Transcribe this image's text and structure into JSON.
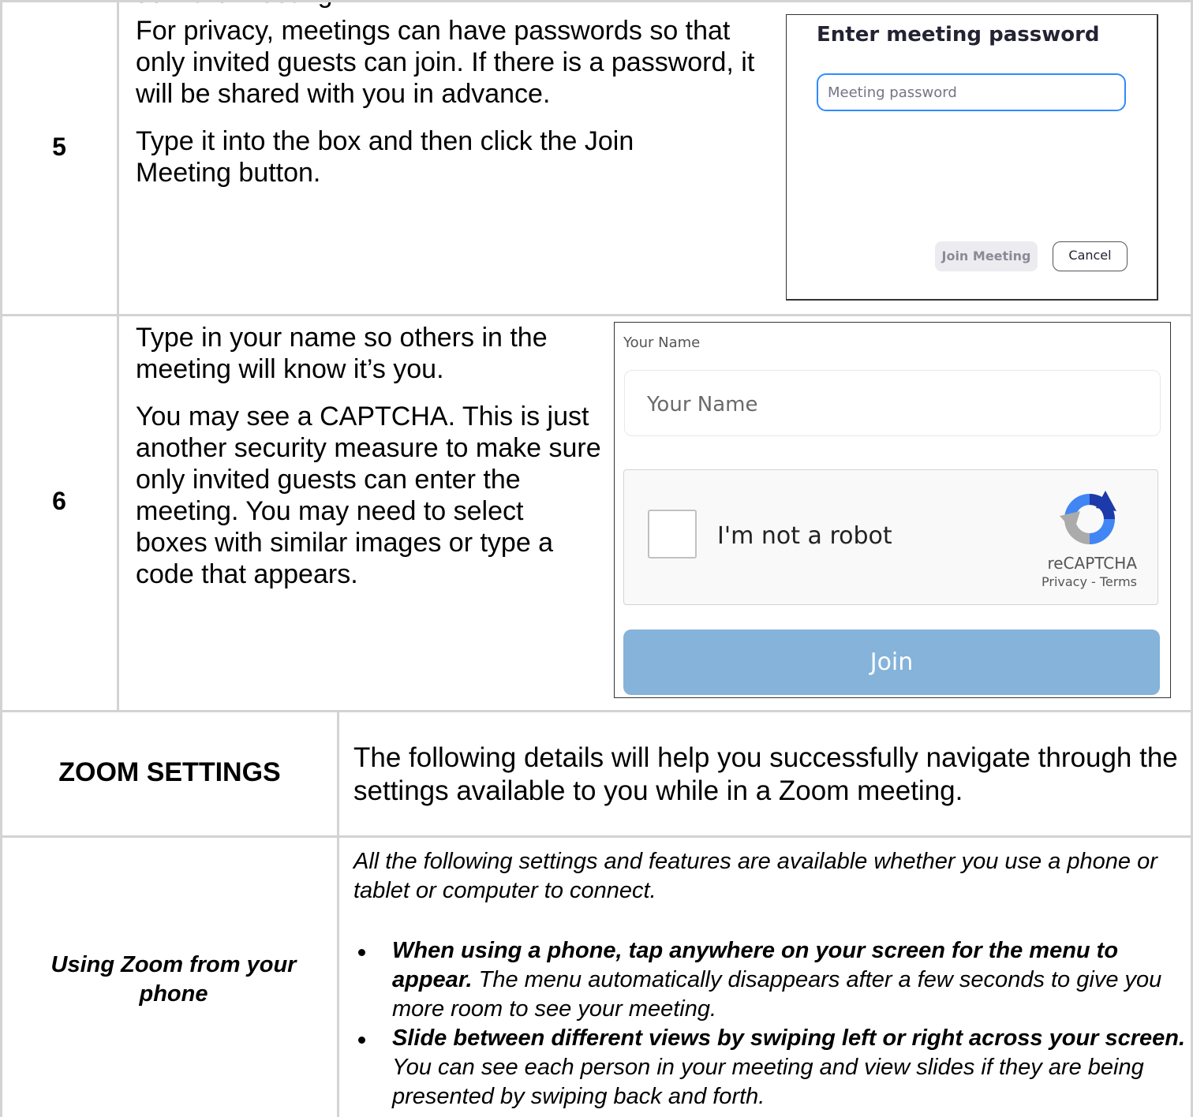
{
  "header_clip": "Join the Meeting",
  "step5": {
    "number": "5",
    "paragraph1": "For privacy, meetings can have passwords so that only invited guests can join. If there is a password, it will be shared with you in advance.",
    "paragraph2": "Type it into the box and then click the Join Meeting button.",
    "dialog": {
      "title": "Enter meeting password",
      "input_placeholder": "Meeting password",
      "join_label": "Join Meeting",
      "cancel_label": "Cancel"
    }
  },
  "step6": {
    "number": "6",
    "paragraph1": "Type in your name so others in the meeting will know it’s you.",
    "paragraph2": "You may see a CAPTCHA. This is just another security measure to make sure only invited guests can enter the meeting. You may need to select boxes with similar images or type a code that appears.",
    "panel": {
      "field_label": "Your Name",
      "input_placeholder": "Your Name",
      "captcha_label": "I'm not a robot",
      "captcha_brand": "reCAPTCHA",
      "captcha_links": "Privacy - Terms",
      "join_label": "Join"
    }
  },
  "settings": {
    "heading": "ZOOM SETTINGS",
    "description": "The following details will help you successfully navigate through the settings available to you while in a Zoom meeting."
  },
  "phone": {
    "heading": "Using Zoom from your phone",
    "intro": "All the following settings and features are available whether you use a phone or tablet or computer to connect.",
    "bullets": [
      {
        "bold": "When using a phone, tap anywhere on your screen for the menu to appear.",
        "text": " The menu automatically disappears after a few seconds to give you more room to see your meeting."
      },
      {
        "bold": "Slide between different views by swiping left or right across your screen.",
        "text": " You can see each person in your meeting and view slides if they are being presented by swiping back and forth."
      }
    ]
  },
  "colors": {
    "zoom_blue": "#2d8cff",
    "join_button": "#85b3da",
    "table_border": "#d3d3d3"
  }
}
